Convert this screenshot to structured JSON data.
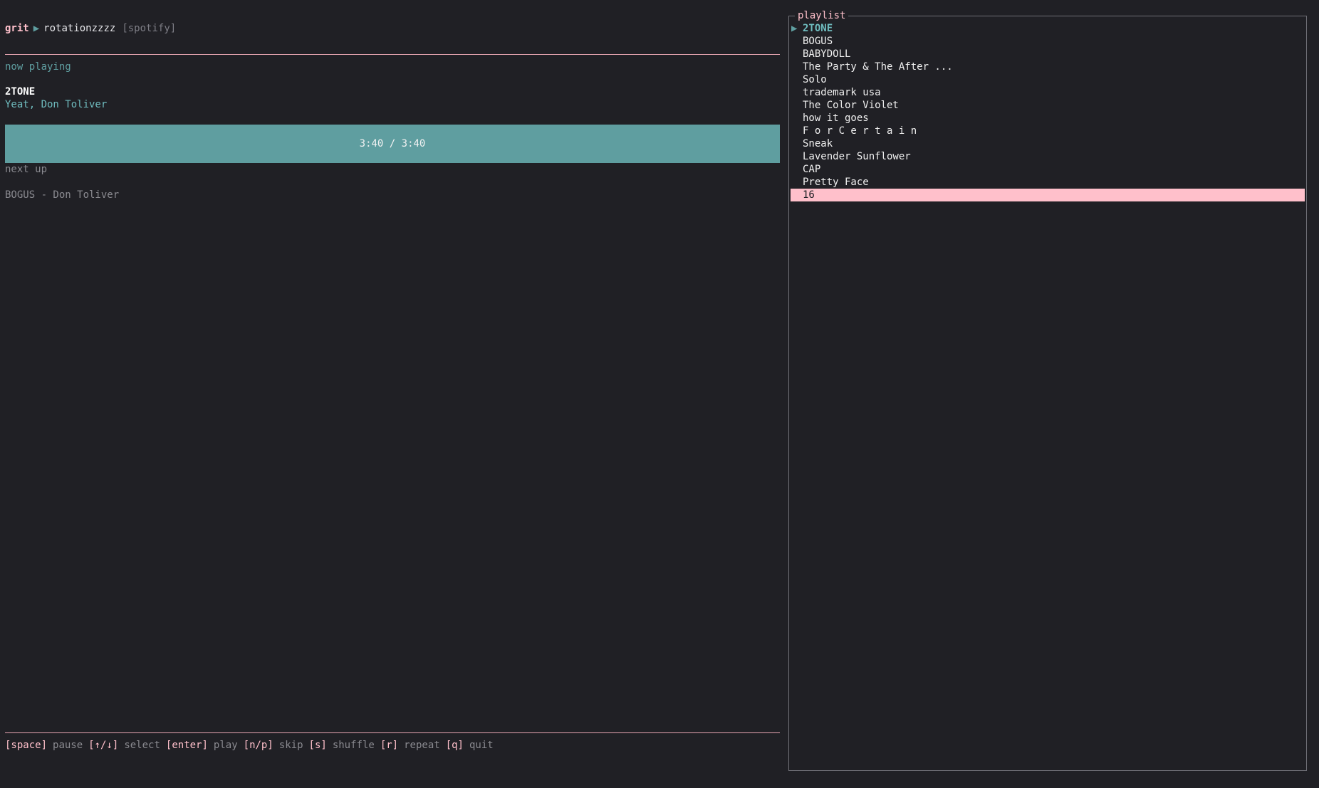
{
  "header": {
    "app_name": "grit",
    "separator_icon": "play-arrow-icon",
    "playlist_name": "rotationzzzz",
    "source": "[spotify]"
  },
  "now_playing": {
    "label": "now playing",
    "title": "2TONE",
    "artist": "Yeat, Don Toliver",
    "progress_text": "3:40 / 3:40",
    "progress_fraction": 1.0
  },
  "next_up": {
    "label": "next up",
    "track": "BOGUS - Don Toliver"
  },
  "footer": {
    "shortcuts": [
      {
        "key": "[space]",
        "action": "pause"
      },
      {
        "key": "[↑/↓]",
        "action": "select"
      },
      {
        "key": "[enter]",
        "action": "play"
      },
      {
        "key": "[n/p]",
        "action": "skip"
      },
      {
        "key": "[s]",
        "action": "shuffle"
      },
      {
        "key": "[r]",
        "action": "repeat"
      },
      {
        "key": "[q]",
        "action": "quit"
      }
    ]
  },
  "playlist": {
    "title": "playlist",
    "playing_marker": "▶",
    "playing_index": 0,
    "selected_index": 13,
    "tracks": [
      "2TONE",
      "BOGUS",
      "BABYDOLL",
      "The Party & The After ...",
      "Solo",
      "trademark usa",
      "The Color Violet",
      "how it goes",
      "F o r C e r t a i n",
      "Sneak",
      "Lavender Sunflower",
      "CAP",
      "Pretty Face",
      "16"
    ]
  },
  "colors": {
    "background": "#202025",
    "accent_pink": "#ffc0cb",
    "accent_teal": "#5f9ea0",
    "muted_text": "#8a8a90"
  }
}
